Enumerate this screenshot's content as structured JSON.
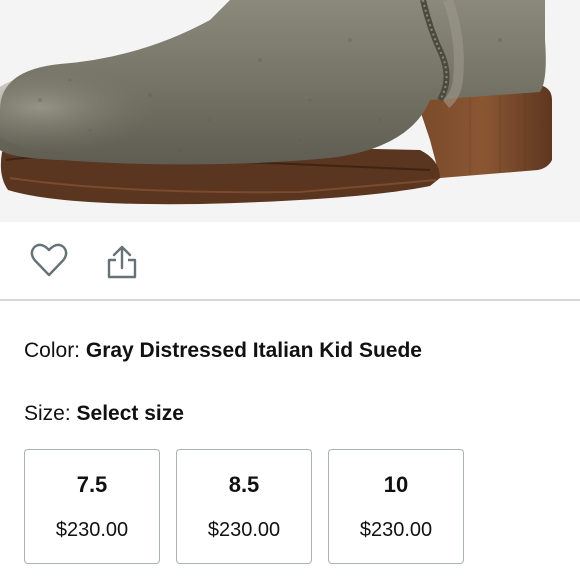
{
  "product": {
    "image_icon": "product-photo-boot",
    "colors": {
      "suede": "#767466",
      "sole": "#5a3520",
      "heel": "#6b3f24",
      "background": "#f4f4f4"
    }
  },
  "actions": {
    "wishlist_icon": "heart-icon",
    "share_icon": "share-icon",
    "icon_color": "#667277"
  },
  "color": {
    "label": "Color: ",
    "value": "Gray Distressed Italian Kid Suede"
  },
  "size": {
    "label": "Size: ",
    "value": "Select size",
    "options": [
      {
        "size": "7.5",
        "price": "$230.00"
      },
      {
        "size": "8.5",
        "price": "$230.00"
      },
      {
        "size": "10",
        "price": "$230.00"
      }
    ]
  }
}
